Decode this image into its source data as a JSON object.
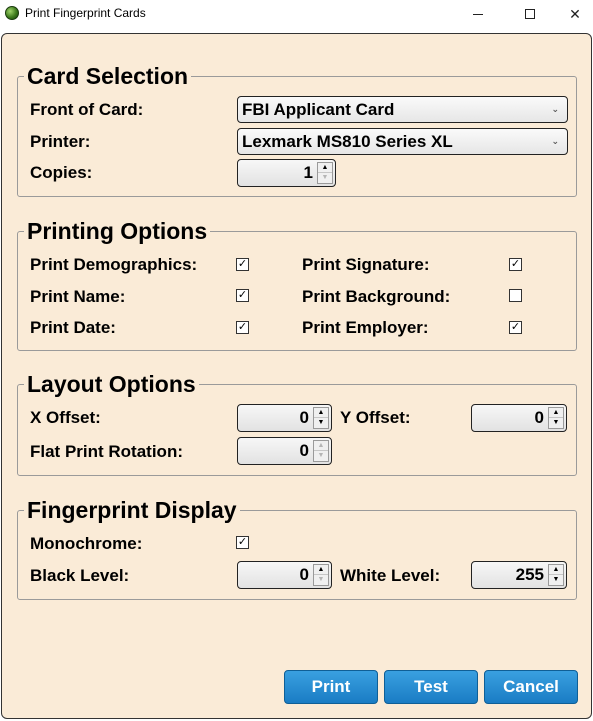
{
  "window": {
    "title": "Print Fingerprint Cards"
  },
  "card_selection": {
    "legend": "Card Selection",
    "front_label": "Front of Card:",
    "front_value": "FBI Applicant Card",
    "printer_label": "Printer:",
    "printer_value": "Lexmark MS810 Series XL",
    "copies_label": "Copies:",
    "copies_value": "1"
  },
  "printing_options": {
    "legend": "Printing Options",
    "items": [
      {
        "label": "Print Demographics:",
        "checked": true
      },
      {
        "label": "Print Name:",
        "checked": true
      },
      {
        "label": "Print Date:",
        "checked": true
      },
      {
        "label": "Print Signature:",
        "checked": true
      },
      {
        "label": "Print Background:",
        "checked": false
      },
      {
        "label": "Print Employer:",
        "checked": true
      }
    ]
  },
  "layout_options": {
    "legend": "Layout Options",
    "x_offset_label": "X Offset:",
    "x_offset_value": "0",
    "y_offset_label": "Y Offset:",
    "y_offset_value": "0",
    "rotation_label": "Flat Print Rotation:",
    "rotation_value": "0"
  },
  "fingerprint_display": {
    "legend": "Fingerprint Display",
    "monochrome_label": "Monochrome:",
    "monochrome_checked": true,
    "black_label": "Black Level:",
    "black_value": "0",
    "white_label": "White Level:",
    "white_value": "255"
  },
  "buttons": {
    "print": "Print",
    "test": "Test",
    "cancel": "Cancel"
  },
  "colors": {
    "panel_background": "#faebd7",
    "button_blue": "#1a7cc4"
  }
}
